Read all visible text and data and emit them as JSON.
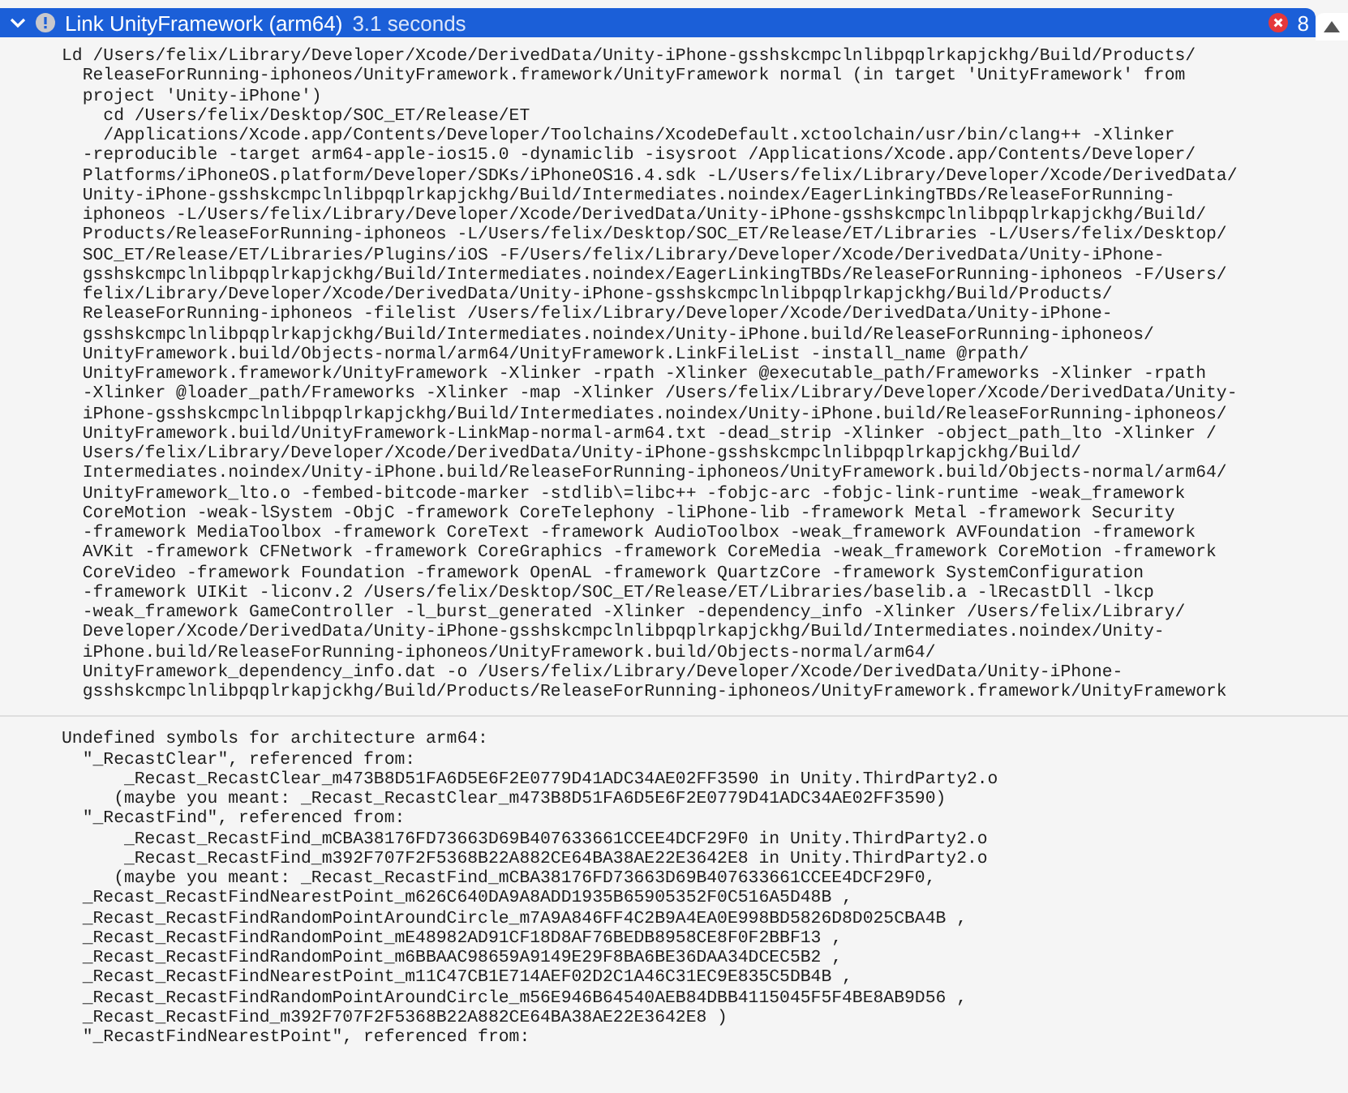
{
  "header": {
    "title": "Link UnityFramework (arm64)",
    "duration": "3.1 seconds",
    "expanded": true,
    "error_count": "8"
  },
  "blocks": [
    {
      "lines": [
        "Ld /Users/felix/Library/Developer/Xcode/DerivedData/Unity-iPhone-gsshskcmpclnlibpqplrkapjckhg/Build/Products/",
        "  ReleaseForRunning-iphoneos/UnityFramework.framework/UnityFramework normal (in target 'UnityFramework' from",
        "  project 'Unity-iPhone')",
        "    cd /Users/felix/Desktop/SOC_ET/Release/ET",
        "    /Applications/Xcode.app/Contents/Developer/Toolchains/XcodeDefault.xctoolchain/usr/bin/clang++ -Xlinker",
        "  -reproducible -target arm64-apple-ios15.0 -dynamiclib -isysroot /Applications/Xcode.app/Contents/Developer/",
        "  Platforms/iPhoneOS.platform/Developer/SDKs/iPhoneOS16.4.sdk -L/Users/felix/Library/Developer/Xcode/DerivedData/",
        "  Unity-iPhone-gsshskcmpclnlibpqplrkapjckhg/Build/Intermediates.noindex/EagerLinkingTBDs/ReleaseForRunning-",
        "  iphoneos -L/Users/felix/Library/Developer/Xcode/DerivedData/Unity-iPhone-gsshskcmpclnlibpqplrkapjckhg/Build/",
        "  Products/ReleaseForRunning-iphoneos -L/Users/felix/Desktop/SOC_ET/Release/ET/Libraries -L/Users/felix/Desktop/",
        "  SOC_ET/Release/ET/Libraries/Plugins/iOS -F/Users/felix/Library/Developer/Xcode/DerivedData/Unity-iPhone-",
        "  gsshskcmpclnlibpqplrkapjckhg/Build/Intermediates.noindex/EagerLinkingTBDs/ReleaseForRunning-iphoneos -F/Users/",
        "  felix/Library/Developer/Xcode/DerivedData/Unity-iPhone-gsshskcmpclnlibpqplrkapjckhg/Build/Products/",
        "  ReleaseForRunning-iphoneos -filelist /Users/felix/Library/Developer/Xcode/DerivedData/Unity-iPhone-",
        "  gsshskcmpclnlibpqplrkapjckhg/Build/Intermediates.noindex/Unity-iPhone.build/ReleaseForRunning-iphoneos/",
        "  UnityFramework.build/Objects-normal/arm64/UnityFramework.LinkFileList -install_name @rpath/",
        "  UnityFramework.framework/UnityFramework -Xlinker -rpath -Xlinker @executable_path/Frameworks -Xlinker -rpath",
        "  -Xlinker @loader_path/Frameworks -Xlinker -map -Xlinker /Users/felix/Library/Developer/Xcode/DerivedData/Unity-",
        "  iPhone-gsshskcmpclnlibpqplrkapjckhg/Build/Intermediates.noindex/Unity-iPhone.build/ReleaseForRunning-iphoneos/",
        "  UnityFramework.build/UnityFramework-LinkMap-normal-arm64.txt -dead_strip -Xlinker -object_path_lto -Xlinker /",
        "  Users/felix/Library/Developer/Xcode/DerivedData/Unity-iPhone-gsshskcmpclnlibpqplrkapjckhg/Build/",
        "  Intermediates.noindex/Unity-iPhone.build/ReleaseForRunning-iphoneos/UnityFramework.build/Objects-normal/arm64/",
        "  UnityFramework_lto.o -fembed-bitcode-marker -stdlib\\=libc++ -fobjc-arc -fobjc-link-runtime -weak_framework",
        "  CoreMotion -weak-lSystem -ObjC -framework CoreTelephony -liPhone-lib -framework Metal -framework Security",
        "  -framework MediaToolbox -framework CoreText -framework AudioToolbox -weak_framework AVFoundation -framework",
        "  AVKit -framework CFNetwork -framework CoreGraphics -framework CoreMedia -weak_framework CoreMotion -framework",
        "  CoreVideo -framework Foundation -framework OpenAL -framework QuartzCore -framework SystemConfiguration",
        "  -framework UIKit -liconv.2 /Users/felix/Desktop/SOC_ET/Release/ET/Libraries/baselib.a -lRecastDll -lkcp",
        "  -weak_framework GameController -l_burst_generated -Xlinker -dependency_info -Xlinker /Users/felix/Library/",
        "  Developer/Xcode/DerivedData/Unity-iPhone-gsshskcmpclnlibpqplrkapjckhg/Build/Intermediates.noindex/Unity-",
        "  iPhone.build/ReleaseForRunning-iphoneos/UnityFramework.build/Objects-normal/arm64/",
        "  UnityFramework_dependency_info.dat -o /Users/felix/Library/Developer/Xcode/DerivedData/Unity-iPhone-",
        "  gsshskcmpclnlibpqplrkapjckhg/Build/Products/ReleaseForRunning-iphoneos/UnityFramework.framework/UnityFramework"
      ]
    },
    {
      "lines": [
        "Undefined symbols for architecture arm64:",
        "  \"_RecastClear\", referenced from:",
        "      _Recast_RecastClear_m473B8D51FA6D5E6F2E0779D41ADC34AE02FF3590 in Unity.ThirdParty2.o",
        "     (maybe you meant: _Recast_RecastClear_m473B8D51FA6D5E6F2E0779D41ADC34AE02FF3590)",
        "  \"_RecastFind\", referenced from:",
        "      _Recast_RecastFind_mCBA38176FD73663D69B407633661CCEE4DCF29F0 in Unity.ThirdParty2.o",
        "      _Recast_RecastFind_m392F707F2F5368B22A882CE64BA38AE22E3642E8 in Unity.ThirdParty2.o",
        "     (maybe you meant: _Recast_RecastFind_mCBA38176FD73663D69B407633661CCEE4DCF29F0,",
        "  _Recast_RecastFindNearestPoint_m626C640DA9A8ADD1935B65905352F0C516A5D48B ,",
        "  _Recast_RecastFindRandomPointAroundCircle_m7A9A846FF4C2B9A4EA0E998BD5826D8D025CBA4B ,",
        "  _Recast_RecastFindRandomPoint_mE48982AD91CF18D8AF76BEDB8958CE8F0F2BBF13 ,",
        "  _Recast_RecastFindRandomPoint_m6BBAAC98659A9149E29F8BA6BE36DAA34DCEC5B2 ,",
        "  _Recast_RecastFindNearestPoint_m11C47CB1E714AEF02D2C1A46C31EC9E835C5DB4B ,",
        "  _Recast_RecastFindRandomPointAroundCircle_m56E946B64540AEB84DBB4115045F5F4BE8AB9D56 ,",
        "  _Recast_RecastFind_m392F707F2F5368B22A882CE64BA38AE22E3642E8 )",
        "  \"_RecastFindNearestPoint\", referenced from:"
      ]
    }
  ]
}
